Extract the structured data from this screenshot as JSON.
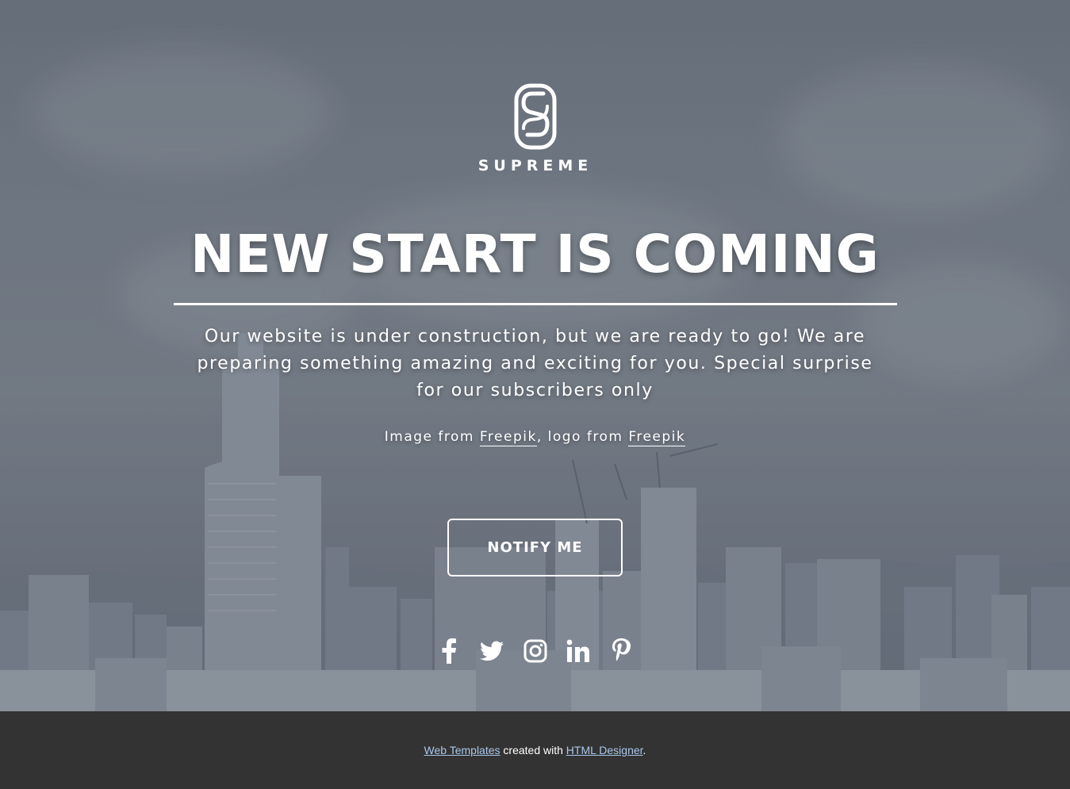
{
  "brand": {
    "name": "SUPREME",
    "logo_icon": "s-monogram-icon"
  },
  "hero": {
    "headline": "NEW START IS COMING",
    "lead": "Our website is under construction, but we are ready to go! We are preparing something amazing and exciting for you. Special surprise for our subscribers only",
    "credit": {
      "image_prefix": "Image from ",
      "image_link": "Freepik",
      "logo_prefix": ", logo from ",
      "logo_link": "Freepik"
    },
    "notify_label": "NOTIFY ME"
  },
  "social": [
    {
      "name": "Facebook",
      "icon": "facebook-icon"
    },
    {
      "name": "Twitter",
      "icon": "twitter-icon"
    },
    {
      "name": "Instagram",
      "icon": "instagram-icon"
    },
    {
      "name": "LinkedIn",
      "icon": "linkedin-icon"
    },
    {
      "name": "Pinterest",
      "icon": "pinterest-icon"
    }
  ],
  "footer": {
    "link1": "Web Templates",
    "middle": " created with ",
    "link2": "HTML Designer",
    "end": "."
  },
  "colors": {
    "footer_bg": "#333333",
    "footer_link": "#a9c7ea",
    "text": "#ffffff"
  }
}
